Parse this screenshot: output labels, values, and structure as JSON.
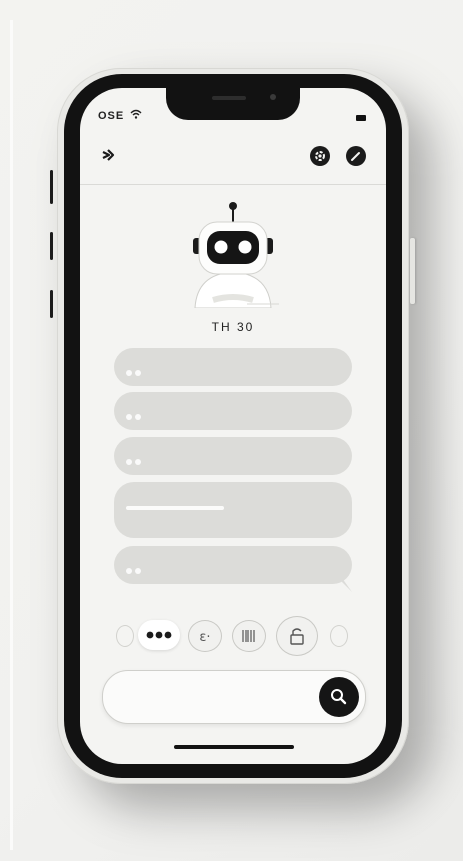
{
  "status_bar": {
    "time": "OSE"
  },
  "header": {
    "back_icon": "back-arrow-icon",
    "settings_icon": "gear-icon",
    "edit_icon": "pencil-icon"
  },
  "bot": {
    "name": "TH   30"
  },
  "chat": {
    "messages": [
      {
        "kind": "typing"
      },
      {
        "kind": "typing"
      },
      {
        "kind": "typing"
      },
      {
        "kind": "line"
      },
      {
        "kind": "typing"
      }
    ]
  },
  "quick_actions": [
    {
      "icon": "more-icon"
    },
    {
      "icon": "emoji-icon"
    },
    {
      "icon": "barcode-icon"
    },
    {
      "icon": "lock-icon"
    }
  ],
  "composer": {
    "value": "",
    "placeholder": "",
    "search_icon": "search-icon"
  },
  "colors": {
    "bezel": "#121212",
    "screen": "#f4f4f2",
    "bubble": "#dcdcd9",
    "accent": "#151515"
  }
}
